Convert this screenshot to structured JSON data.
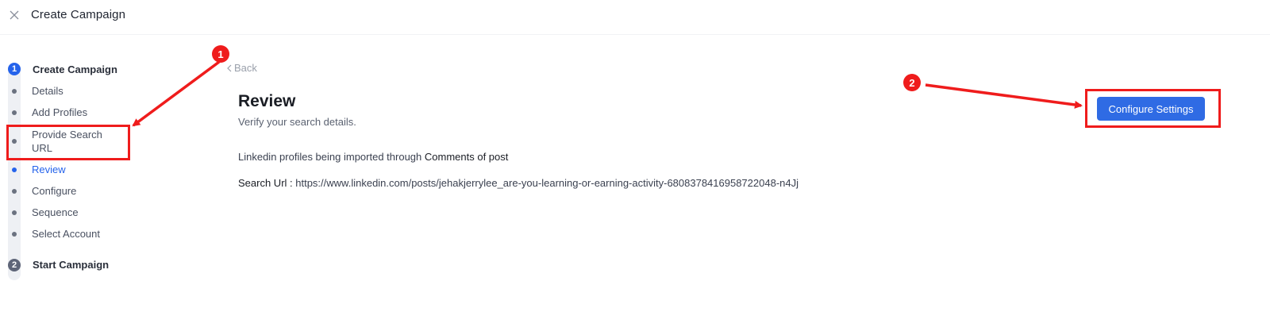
{
  "header": {
    "title": "Create Campaign",
    "close_icon": "close-icon"
  },
  "stepper": {
    "steps": [
      {
        "number": "1",
        "label": "Create Campaign",
        "state": "active"
      },
      {
        "number": "2",
        "label": "Start Campaign",
        "state": "inactive"
      }
    ],
    "sub_steps": [
      {
        "label": "Details"
      },
      {
        "label": "Add Profiles"
      },
      {
        "label": "Provide Search URL"
      },
      {
        "label": "Review",
        "current": true
      },
      {
        "label": "Configure"
      },
      {
        "label": "Sequence"
      },
      {
        "label": "Select Account"
      }
    ]
  },
  "main": {
    "back_label": "Back",
    "title": "Review",
    "subtitle": "Verify your search details.",
    "import_prefix": "Linkedin profiles being imported through ",
    "import_source": "Comments of post",
    "search_label": "Search Url : ",
    "search_url": "https://www.linkedin.com/posts/jehakjerrylee_are-you-learning-or-earning-activity-6808378416958722048-n4Jj",
    "configure_button": "Configure Settings"
  },
  "annotations": [
    {
      "badge": "1"
    },
    {
      "badge": "2"
    }
  ],
  "colors": {
    "primary": "#2f6be4",
    "step_active": "#2563eb",
    "step_inactive": "#5e6578",
    "annotation": "#ef1c1c"
  }
}
